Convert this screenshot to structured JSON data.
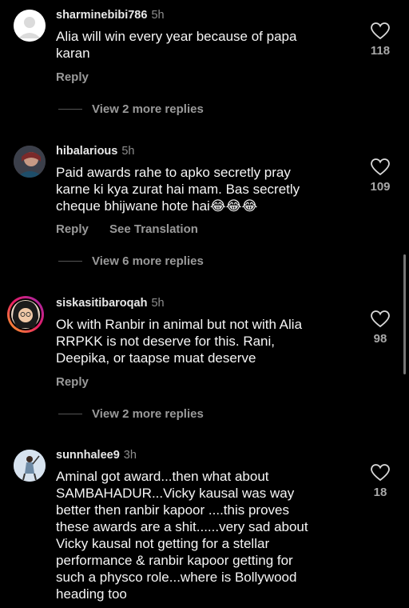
{
  "comments": [
    {
      "username": "sharminebibi786",
      "time": "5h",
      "text_lines": [
        "Alia will win every year because of papa",
        "karan"
      ],
      "reply": "Reply",
      "translate": "",
      "likes": "118",
      "view_replies": "View 2 more replies",
      "avatar": "default-avatar"
    },
    {
      "username": "hibalarious",
      "time": "5h",
      "text_lines": [
        "Paid awards rahe to apko secretly pray",
        "karne ki kya zurat hai mam. Bas secretly",
        "cheque bhijwane  hote hai😂😂😂"
      ],
      "reply": "Reply",
      "translate": "See Translation",
      "likes": "109",
      "view_replies": "View 6 more replies",
      "avatar": "user-avatar"
    },
    {
      "username": "siskasitibaroqah",
      "time": "5h",
      "text_lines": [
        "Ok with Ranbir in animal but not with Alia",
        "RRPKK is not deserve for this. Rani,",
        "Deepika, or taapse muat deserve"
      ],
      "reply": "Reply",
      "translate": "",
      "likes": "98",
      "view_replies": "View 2 more replies",
      "avatar": "story-avatar"
    },
    {
      "username": "sunnhalee9",
      "time": "3h",
      "text_lines": [
        "Aminal got award...then what about",
        "SAMBAHADUR...Vicky kausal was way",
        "better then ranbir kapoor ....this proves",
        "these awards  are a shit......very sad about",
        "Vicky kausal not getting for a stellar",
        "performance & ranbir kapoor getting for",
        "such a physco role...where is Bollywood",
        "heading too"
      ],
      "reply": "",
      "translate": "",
      "likes": "18",
      "view_replies": "",
      "avatar": "user-avatar"
    }
  ],
  "icons": {
    "like": "heart-outline-icon"
  },
  "colors": {
    "background": "#000000",
    "secondary_text": "#9a9a9a"
  }
}
